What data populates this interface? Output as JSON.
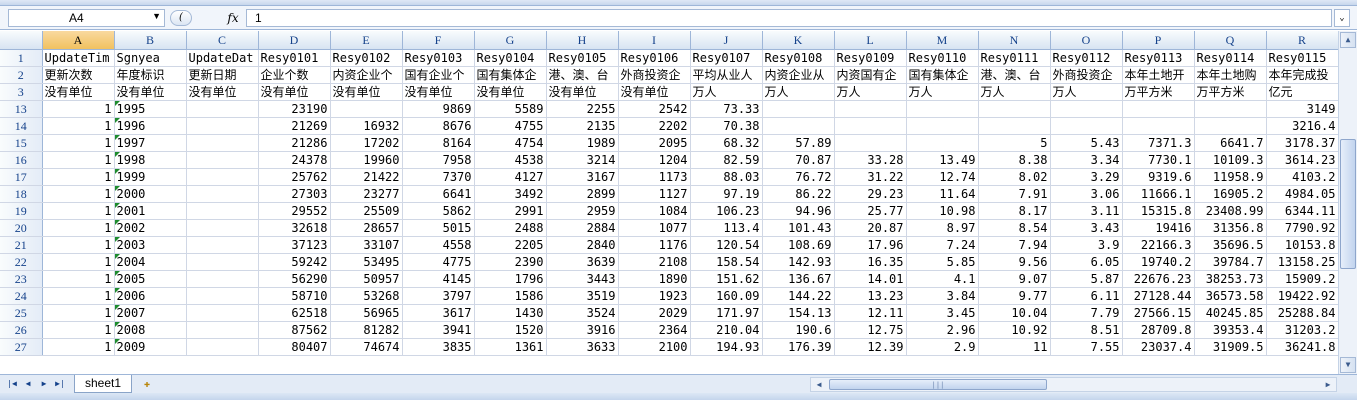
{
  "formula_bar": {
    "name_box": "A4",
    "fx_label": "fx",
    "value": "1"
  },
  "columns": [
    "A",
    "B",
    "C",
    "D",
    "E",
    "F",
    "G",
    "H",
    "I",
    "J",
    "K",
    "L",
    "M",
    "N",
    "O",
    "P",
    "Q",
    "R"
  ],
  "selected_column": "A",
  "header_rows": [
    {
      "row": "1",
      "cells": [
        "UpdateTim",
        "Sgnyea",
        "UpdateDat",
        "Resy0101",
        "Resy0102",
        "Resy0103",
        "Resy0104",
        "Resy0105",
        "Resy0106",
        "Resy0107",
        "Resy0108",
        "Resy0109",
        "Resy0110",
        "Resy0111",
        "Resy0112",
        "Resy0113",
        "Resy0114",
        "Resy0115"
      ]
    },
    {
      "row": "2",
      "cells": [
        "更新次数",
        "年度标识",
        "更新日期",
        "企业个数",
        "内资企业个",
        "国有企业个",
        "国有集体企",
        "港、澳、台",
        "外商投资企",
        "平均从业人",
        "内资企业从",
        "内资国有企",
        "国有集体企",
        "港、澳、台",
        "外商投资企",
        "本年土地开",
        "本年土地购",
        "本年完成投"
      ]
    },
    {
      "row": "3",
      "cells": [
        "没有单位",
        "没有单位",
        "没有单位",
        "没有单位",
        "没有单位",
        "没有单位",
        "没有单位",
        "没有单位",
        "没有单位",
        "万人",
        "万人",
        "万人",
        "万人",
        "万人",
        "万人",
        "万平方米",
        "万平方米",
        "亿元"
      ]
    }
  ],
  "data_rows": [
    {
      "row": "13",
      "cells": [
        "1",
        "1995",
        "",
        "23190",
        "",
        "9869",
        "5589",
        "2255",
        "2542",
        "73.33",
        "",
        "",
        "",
        "",
        "",
        "",
        "",
        "3149"
      ]
    },
    {
      "row": "14",
      "cells": [
        "1",
        "1996",
        "",
        "21269",
        "16932",
        "8676",
        "4755",
        "2135",
        "2202",
        "70.38",
        "",
        "",
        "",
        "",
        "",
        "",
        "",
        "3216.4"
      ]
    },
    {
      "row": "15",
      "cells": [
        "1",
        "1997",
        "",
        "21286",
        "17202",
        "8164",
        "4754",
        "1989",
        "2095",
        "68.32",
        "57.89",
        "",
        "",
        "5",
        "5.43",
        "7371.3",
        "6641.7",
        "3178.37"
      ]
    },
    {
      "row": "16",
      "cells": [
        "1",
        "1998",
        "",
        "24378",
        "19960",
        "7958",
        "4538",
        "3214",
        "1204",
        "82.59",
        "70.87",
        "33.28",
        "13.49",
        "8.38",
        "3.34",
        "7730.1",
        "10109.3",
        "3614.23"
      ]
    },
    {
      "row": "17",
      "cells": [
        "1",
        "1999",
        "",
        "25762",
        "21422",
        "7370",
        "4127",
        "3167",
        "1173",
        "88.03",
        "76.72",
        "31.22",
        "12.74",
        "8.02",
        "3.29",
        "9319.6",
        "11958.9",
        "4103.2"
      ]
    },
    {
      "row": "18",
      "cells": [
        "1",
        "2000",
        "",
        "27303",
        "23277",
        "6641",
        "3492",
        "2899",
        "1127",
        "97.19",
        "86.22",
        "29.23",
        "11.64",
        "7.91",
        "3.06",
        "11666.1",
        "16905.2",
        "4984.05"
      ]
    },
    {
      "row": "19",
      "cells": [
        "1",
        "2001",
        "",
        "29552",
        "25509",
        "5862",
        "2991",
        "2959",
        "1084",
        "106.23",
        "94.96",
        "25.77",
        "10.98",
        "8.17",
        "3.11",
        "15315.8",
        "23408.99",
        "6344.11"
      ]
    },
    {
      "row": "20",
      "cells": [
        "1",
        "2002",
        "",
        "32618",
        "28657",
        "5015",
        "2488",
        "2884",
        "1077",
        "113.4",
        "101.43",
        "20.87",
        "8.97",
        "8.54",
        "3.43",
        "19416",
        "31356.8",
        "7790.92"
      ]
    },
    {
      "row": "21",
      "cells": [
        "1",
        "2003",
        "",
        "37123",
        "33107",
        "4558",
        "2205",
        "2840",
        "1176",
        "120.54",
        "108.69",
        "17.96",
        "7.24",
        "7.94",
        "3.9",
        "22166.3",
        "35696.5",
        "10153.8"
      ]
    },
    {
      "row": "22",
      "cells": [
        "1",
        "2004",
        "",
        "59242",
        "53495",
        "4775",
        "2390",
        "3639",
        "2108",
        "158.54",
        "142.93",
        "16.35",
        "5.85",
        "9.56",
        "6.05",
        "19740.2",
        "39784.7",
        "13158.25"
      ]
    },
    {
      "row": "23",
      "cells": [
        "1",
        "2005",
        "",
        "56290",
        "50957",
        "4145",
        "1796",
        "3443",
        "1890",
        "151.62",
        "136.67",
        "14.01",
        "4.1",
        "9.07",
        "5.87",
        "22676.23",
        "38253.73",
        "15909.2"
      ]
    },
    {
      "row": "24",
      "cells": [
        "1",
        "2006",
        "",
        "58710",
        "53268",
        "3797",
        "1586",
        "3519",
        "1923",
        "160.09",
        "144.22",
        "13.23",
        "3.84",
        "9.77",
        "6.11",
        "27128.44",
        "36573.58",
        "19422.92"
      ]
    },
    {
      "row": "25",
      "cells": [
        "1",
        "2007",
        "",
        "62518",
        "56965",
        "3617",
        "1430",
        "3524",
        "2029",
        "171.97",
        "154.13",
        "12.11",
        "3.45",
        "10.04",
        "7.79",
        "27566.15",
        "40245.85",
        "25288.84"
      ]
    },
    {
      "row": "26",
      "cells": [
        "1",
        "2008",
        "",
        "87562",
        "81282",
        "3941",
        "1520",
        "3916",
        "2364",
        "210.04",
        "190.6",
        "12.75",
        "2.96",
        "10.92",
        "8.51",
        "28709.8",
        "39353.4",
        "31203.2"
      ]
    },
    {
      "row": "27",
      "cells": [
        "1",
        "2009",
        "",
        "80407",
        "74674",
        "3835",
        "1361",
        "3633",
        "2100",
        "194.93",
        "176.39",
        "12.39",
        "2.9",
        "11",
        "7.55",
        "23037.4",
        "31909.5",
        "36241.8"
      ]
    }
  ],
  "sheet_tabs": [
    "sheet1"
  ]
}
